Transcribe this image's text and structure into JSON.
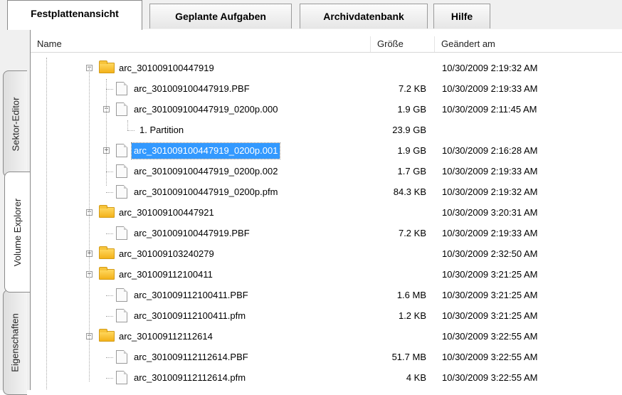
{
  "tabs": [
    "Festplattenansicht",
    "Geplante Aufgaben",
    "Archivdatenbank",
    "Hilfe"
  ],
  "side_tabs": [
    "Sektor-Editor",
    "Volume Explorer",
    "Eigenschaften"
  ],
  "columns": {
    "name": "Name",
    "size": "Größe",
    "modified": "Geändert am"
  },
  "rows": [
    {
      "name": "arc_301009100447919",
      "size": "",
      "date": "10/30/2009 2:19:32 AM",
      "kind": "folder",
      "level": 0,
      "expander": "minus"
    },
    {
      "name": "arc_301009100447919.PBF",
      "size": "7.2 KB",
      "date": "10/30/2009 2:19:33 AM",
      "kind": "file",
      "level": 1,
      "expander": ""
    },
    {
      "name": "arc_301009100447919_0200p.000",
      "size": "1.9 GB",
      "date": "10/30/2009 2:11:45 AM",
      "kind": "file",
      "level": 1,
      "expander": "minus"
    },
    {
      "name": "1. Partition",
      "size": "23.9 GB",
      "date": "",
      "kind": "none",
      "level": 2,
      "expander": ""
    },
    {
      "name": "arc_301009100447919_0200p.001",
      "size": "1.9 GB",
      "date": "10/30/2009 2:16:28 AM",
      "kind": "file",
      "level": 1,
      "expander": "plus",
      "selected": true
    },
    {
      "name": "arc_301009100447919_0200p.002",
      "size": "1.7 GB",
      "date": "10/30/2009 2:19:33 AM",
      "kind": "file",
      "level": 1,
      "expander": ""
    },
    {
      "name": "arc_301009100447919_0200p.pfm",
      "size": "84.3 KB",
      "date": "10/30/2009 2:19:32 AM",
      "kind": "file",
      "level": 1,
      "expander": ""
    },
    {
      "name": "arc_301009100447921",
      "size": "",
      "date": "10/30/2009 3:20:31 AM",
      "kind": "folder",
      "level": 0,
      "expander": "minus"
    },
    {
      "name": "arc_301009100447919.PBF",
      "size": "7.2 KB",
      "date": "10/30/2009 2:19:33 AM",
      "kind": "file",
      "level": 1,
      "expander": ""
    },
    {
      "name": "arc_301009103240279",
      "size": "",
      "date": "10/30/2009 2:32:50 AM",
      "kind": "folder",
      "level": 0,
      "expander": "plus"
    },
    {
      "name": "arc_301009112100411",
      "size": "",
      "date": "10/30/2009 3:21:25 AM",
      "kind": "folder",
      "level": 0,
      "expander": "minus"
    },
    {
      "name": "arc_301009112100411.PBF",
      "size": "1.6 MB",
      "date": "10/30/2009 3:21:25 AM",
      "kind": "file",
      "level": 1,
      "expander": ""
    },
    {
      "name": "arc_301009112100411.pfm",
      "size": "1.2 KB",
      "date": "10/30/2009 3:21:25 AM",
      "kind": "file",
      "level": 1,
      "expander": ""
    },
    {
      "name": "arc_301009112112614",
      "size": "",
      "date": "10/30/2009 3:22:55 AM",
      "kind": "folder",
      "level": 0,
      "expander": "minus"
    },
    {
      "name": "arc_301009112112614.PBF",
      "size": "51.7 MB",
      "date": "10/30/2009 3:22:55 AM",
      "kind": "file",
      "level": 1,
      "expander": ""
    },
    {
      "name": "arc_301009112112614.pfm",
      "size": "4 KB",
      "date": "10/30/2009 3:22:55 AM",
      "kind": "file",
      "level": 1,
      "expander": ""
    }
  ]
}
